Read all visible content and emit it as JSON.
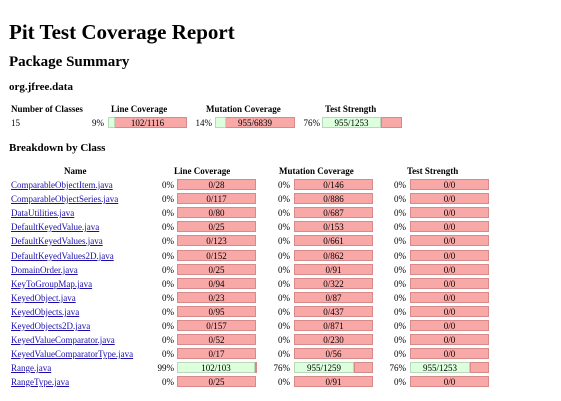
{
  "title": "Pit Test Coverage Report",
  "package_summary": {
    "heading": "Package Summary",
    "package_name": "org.jfree.data",
    "headers": {
      "classes": "Number of Classes",
      "line": "Line Coverage",
      "mutation": "Mutation Coverage",
      "strength": "Test Strength"
    },
    "row": {
      "classes": "15",
      "line_pct": "9%",
      "line_ratio": "102/1116",
      "line_value": 0.09,
      "mutation_pct": "14%",
      "mutation_ratio": "955/6839",
      "mutation_value": 0.14,
      "strength_pct": "76%",
      "strength_ratio": "955/1253",
      "strength_value": 0.76
    }
  },
  "breakdown": {
    "heading": "Breakdown by Class",
    "headers": {
      "name": "Name",
      "line": "Line Coverage",
      "mutation": "Mutation Coverage",
      "strength": "Test Strength"
    },
    "rows": [
      {
        "name": "ComparableObjectItem.java",
        "line_pct": "0%",
        "line_ratio": "0/28",
        "line_value": 0,
        "mut_pct": "0%",
        "mut_ratio": "0/146",
        "mut_value": 0,
        "str_pct": "0%",
        "str_ratio": "0/0",
        "str_value": 0
      },
      {
        "name": "ComparableObjectSeries.java",
        "line_pct": "0%",
        "line_ratio": "0/117",
        "line_value": 0,
        "mut_pct": "0%",
        "mut_ratio": "0/886",
        "mut_value": 0,
        "str_pct": "0%",
        "str_ratio": "0/0",
        "str_value": 0
      },
      {
        "name": "DataUtilities.java",
        "line_pct": "0%",
        "line_ratio": "0/80",
        "line_value": 0,
        "mut_pct": "0%",
        "mut_ratio": "0/687",
        "mut_value": 0,
        "str_pct": "0%",
        "str_ratio": "0/0",
        "str_value": 0
      },
      {
        "name": "DefaultKeyedValue.java",
        "line_pct": "0%",
        "line_ratio": "0/25",
        "line_value": 0,
        "mut_pct": "0%",
        "mut_ratio": "0/153",
        "mut_value": 0,
        "str_pct": "0%",
        "str_ratio": "0/0",
        "str_value": 0
      },
      {
        "name": "DefaultKeyedValues.java",
        "line_pct": "0%",
        "line_ratio": "0/123",
        "line_value": 0,
        "mut_pct": "0%",
        "mut_ratio": "0/661",
        "mut_value": 0,
        "str_pct": "0%",
        "str_ratio": "0/0",
        "str_value": 0
      },
      {
        "name": "DefaultKeyedValues2D.java",
        "line_pct": "0%",
        "line_ratio": "0/152",
        "line_value": 0,
        "mut_pct": "0%",
        "mut_ratio": "0/862",
        "mut_value": 0,
        "str_pct": "0%",
        "str_ratio": "0/0",
        "str_value": 0
      },
      {
        "name": "DomainOrder.java",
        "line_pct": "0%",
        "line_ratio": "0/25",
        "line_value": 0,
        "mut_pct": "0%",
        "mut_ratio": "0/91",
        "mut_value": 0,
        "str_pct": "0%",
        "str_ratio": "0/0",
        "str_value": 0
      },
      {
        "name": "KeyToGroupMap.java",
        "line_pct": "0%",
        "line_ratio": "0/94",
        "line_value": 0,
        "mut_pct": "0%",
        "mut_ratio": "0/322",
        "mut_value": 0,
        "str_pct": "0%",
        "str_ratio": "0/0",
        "str_value": 0
      },
      {
        "name": "KeyedObject.java",
        "line_pct": "0%",
        "line_ratio": "0/23",
        "line_value": 0,
        "mut_pct": "0%",
        "mut_ratio": "0/87",
        "mut_value": 0,
        "str_pct": "0%",
        "str_ratio": "0/0",
        "str_value": 0
      },
      {
        "name": "KeyedObjects.java",
        "line_pct": "0%",
        "line_ratio": "0/95",
        "line_value": 0,
        "mut_pct": "0%",
        "mut_ratio": "0/437",
        "mut_value": 0,
        "str_pct": "0%",
        "str_ratio": "0/0",
        "str_value": 0
      },
      {
        "name": "KeyedObjects2D.java",
        "line_pct": "0%",
        "line_ratio": "0/157",
        "line_value": 0,
        "mut_pct": "0%",
        "mut_ratio": "0/871",
        "mut_value": 0,
        "str_pct": "0%",
        "str_ratio": "0/0",
        "str_value": 0
      },
      {
        "name": "KeyedValueComparator.java",
        "line_pct": "0%",
        "line_ratio": "0/52",
        "line_value": 0,
        "mut_pct": "0%",
        "mut_ratio": "0/230",
        "mut_value": 0,
        "str_pct": "0%",
        "str_ratio": "0/0",
        "str_value": 0
      },
      {
        "name": "KeyedValueComparatorType.java",
        "line_pct": "0%",
        "line_ratio": "0/17",
        "line_value": 0,
        "mut_pct": "0%",
        "mut_ratio": "0/56",
        "mut_value": 0,
        "str_pct": "0%",
        "str_ratio": "0/0",
        "str_value": 0
      },
      {
        "name": "Range.java",
        "line_pct": "99%",
        "line_ratio": "102/103",
        "line_value": 0.99,
        "mut_pct": "76%",
        "mut_ratio": "955/1259",
        "mut_value": 0.76,
        "str_pct": "76%",
        "str_ratio": "955/1253",
        "str_value": 0.76
      },
      {
        "name": "RangeType.java",
        "line_pct": "0%",
        "line_ratio": "0/25",
        "line_value": 0,
        "mut_pct": "0%",
        "mut_ratio": "0/91",
        "mut_value": 0,
        "str_pct": "0%",
        "str_ratio": "0/0",
        "str_value": 0
      }
    ]
  },
  "colors": {
    "covered": "#ddffdd",
    "uncovered": "#f9a8a8",
    "link": "#1a0dab"
  }
}
